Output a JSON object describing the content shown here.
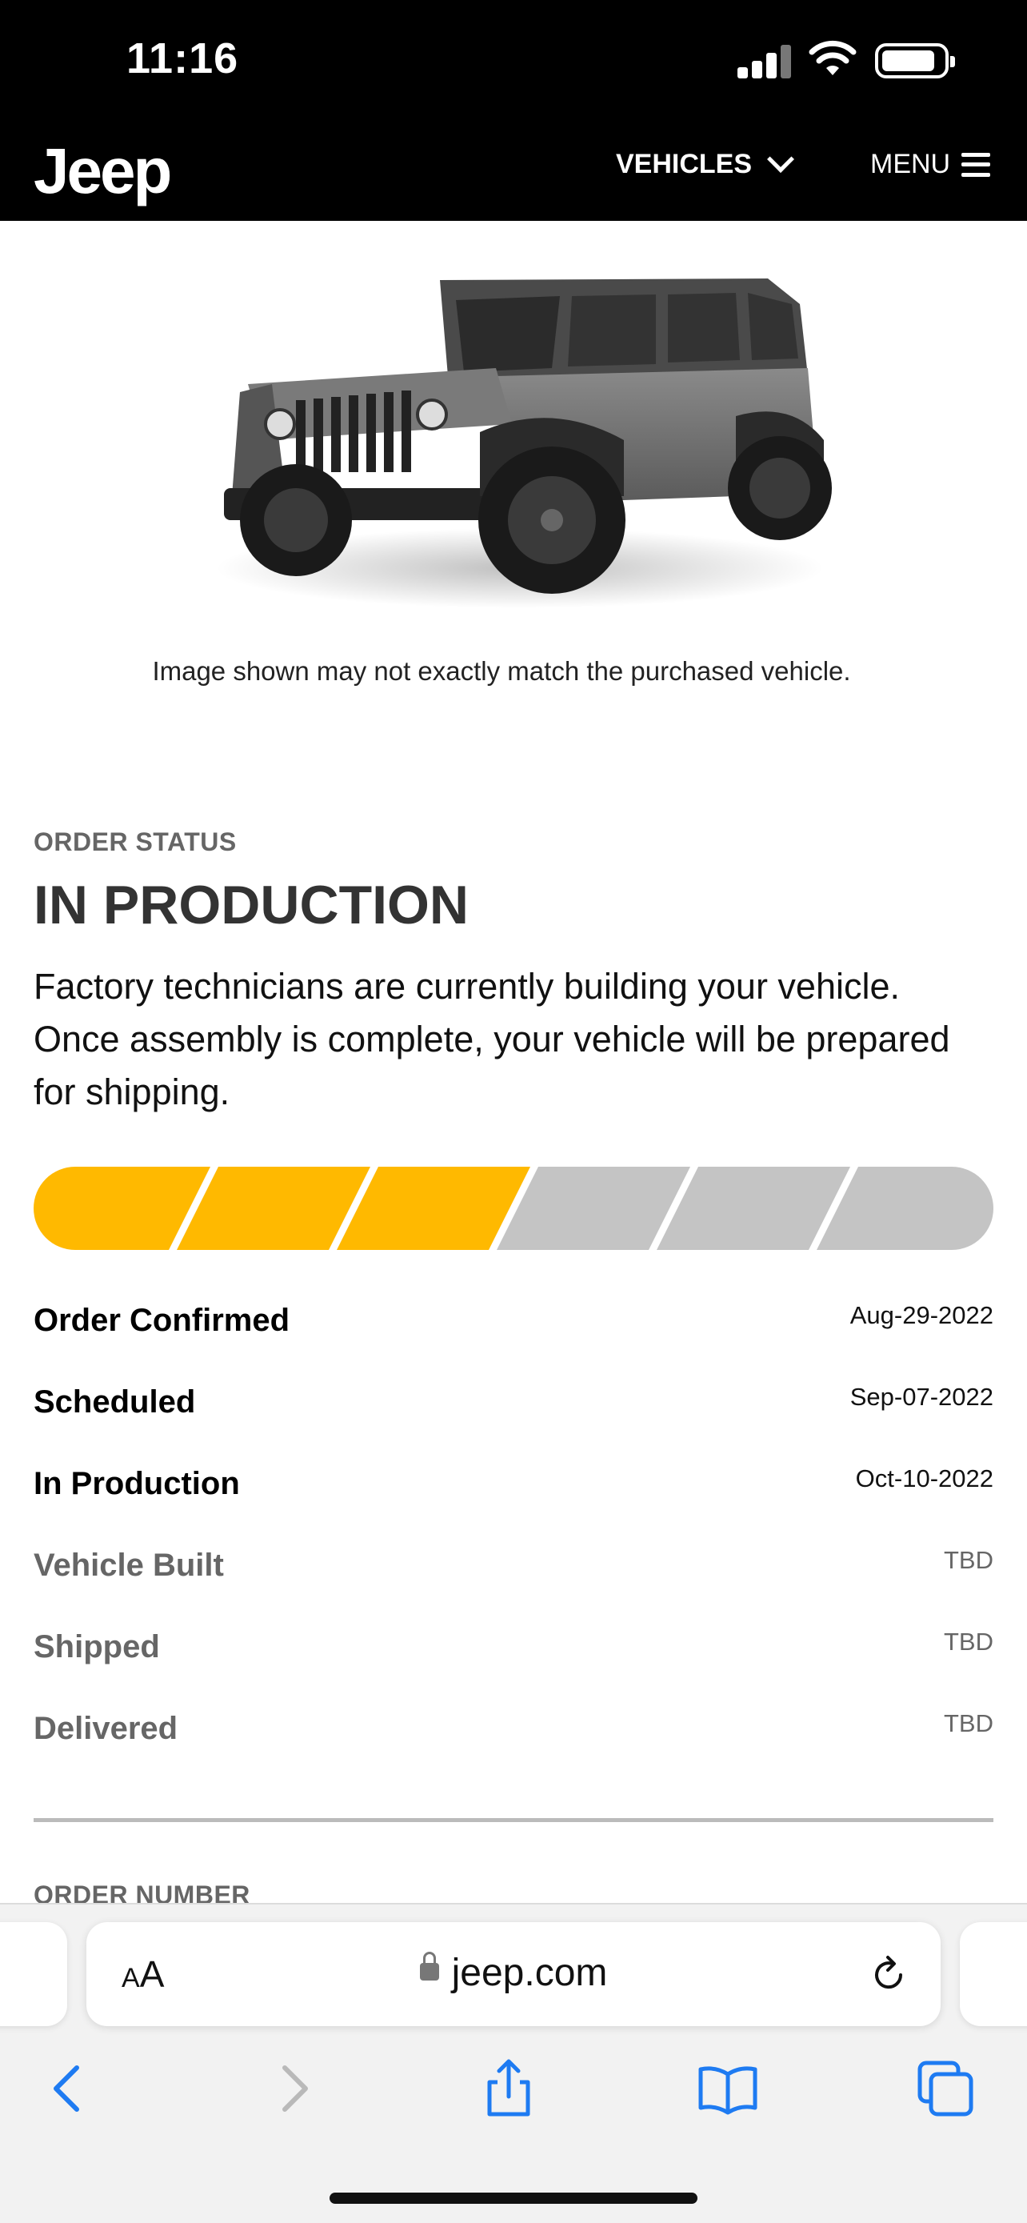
{
  "status_bar": {
    "time": "11:16"
  },
  "header": {
    "logo": "Jeep",
    "vehicles_label": "VEHICLES",
    "menu_label": "MENU"
  },
  "vehicle": {
    "disclaimer": "Image shown may not exactly match the purchased vehicle."
  },
  "order": {
    "section_label": "ORDER STATUS",
    "status_title": "IN PRODUCTION",
    "status_description": "Factory technicians are currently building your vehicle. Once assembly is complete, your vehicle will be prepared for shipping.",
    "progress": {
      "completed_segments": 3,
      "total_segments": 6
    },
    "milestones": [
      {
        "name": "Order Confirmed",
        "date": "Aug-29-2022",
        "state": "done"
      },
      {
        "name": "Scheduled",
        "date": "Sep-07-2022",
        "state": "done"
      },
      {
        "name": "In Production",
        "date": "Oct-10-2022",
        "state": "done"
      },
      {
        "name": "Vehicle Built",
        "date": "TBD",
        "state": "pending"
      },
      {
        "name": "Shipped",
        "date": "TBD",
        "state": "pending"
      },
      {
        "name": "Delivered",
        "date": "TBD",
        "state": "pending"
      }
    ],
    "order_number_label": "ORDER NUMBER"
  },
  "browser": {
    "text_size_label_small": "A",
    "text_size_label_large": "A",
    "url": "jeep.com"
  },
  "colors": {
    "progress_complete": "#FFB900",
    "progress_incomplete": "#C4C4C4",
    "header_bg": "#000000",
    "ios_blue": "#1E7BF2"
  },
  "icons": [
    "signal-icon",
    "wifi-icon",
    "battery-icon",
    "chevron-down-icon",
    "hamburger-icon",
    "lock-icon",
    "reload-icon",
    "back-icon",
    "forward-icon",
    "share-icon",
    "bookmarks-icon",
    "tabs-icon"
  ]
}
